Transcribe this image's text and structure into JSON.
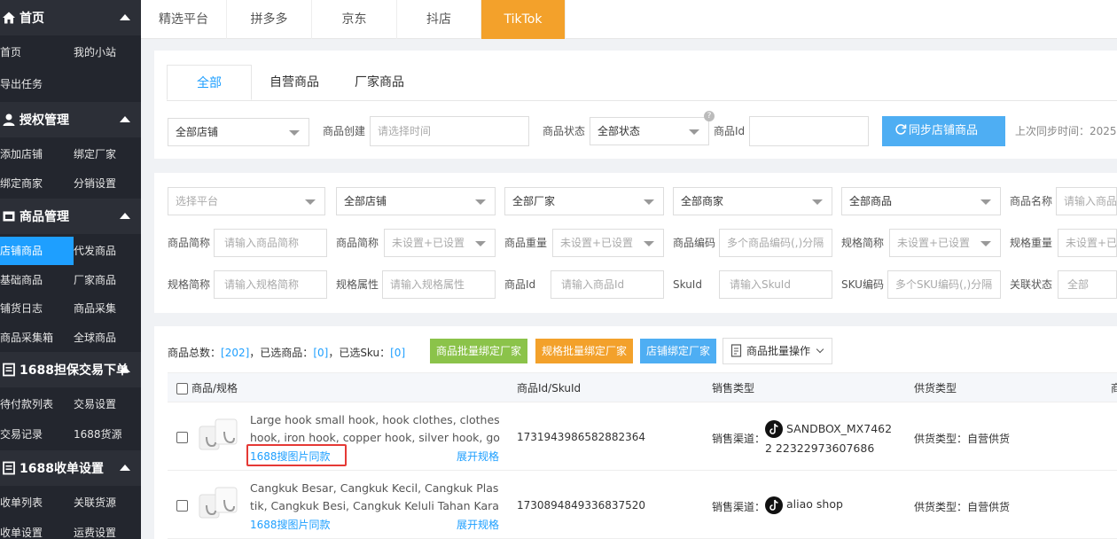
{
  "sidebar": {
    "sections": [
      {
        "title": "首页",
        "icon": "home-icon",
        "items": [
          "首页",
          "我的小站",
          "导出任务"
        ]
      },
      {
        "title": "授权管理",
        "icon": "user-icon",
        "items": [
          "添加店铺",
          "绑定厂家",
          "绑定商家",
          "分销设置"
        ]
      },
      {
        "title": "商品管理",
        "icon": "box-icon",
        "items": [
          "店铺商品",
          "代发商品",
          "基础商品",
          "厂家商品",
          "铺货日志",
          "商品采集",
          "商品采集箱",
          "全球商品"
        ]
      },
      {
        "title": "1688担保交易下单",
        "icon": "list-icon",
        "items": [
          "待付款列表",
          "交易设置",
          "交易记录",
          "1688货源"
        ]
      },
      {
        "title": "1688收单设置",
        "icon": "list-icon",
        "items": [
          "收单列表",
          "关联货源",
          "收单设置",
          "运费设置"
        ]
      }
    ]
  },
  "top_tabs": [
    "精选平台",
    "拼多多",
    "京东",
    "抖店",
    "TikTok"
  ],
  "sub_tabs": [
    "全部",
    "自营商品",
    "厂家商品"
  ],
  "filter1": {
    "shop_select": "全部店铺",
    "created_label": "商品创建",
    "created_placeholder": "请选择时间",
    "status_label": "商品状态",
    "status_select": "全部状态",
    "id_label": "商品Id",
    "sync_button": "同步店铺商品",
    "last_sync": "上次同步时间：2025-"
  },
  "filter2": {
    "row1": {
      "platform_placeholder": "选择平台",
      "shop": "全部店铺",
      "factory": "全部厂家",
      "merchant": "全部商家",
      "goods": "全部商品",
      "name_label": "商品名称",
      "name_placeholder": "请输入商品"
    },
    "row2": {
      "short_label": "商品简称",
      "short_placeholder": "请输入商品简称",
      "short2_label": "商品简称",
      "short2_select": "未设置+已设置",
      "weight_label": "商品重量",
      "weight_select": "未设置+已设置",
      "code_label": "商品编码",
      "code_placeholder": "多个商品编码(,)分隔",
      "spec_short_label": "规格简称",
      "spec_short_select": "未设置+已设置",
      "spec_weight_label": "规格重量",
      "spec_weight_select": "未设置+已设"
    },
    "row3": {
      "spec_short_label": "规格简称",
      "spec_short_placeholder": "请输入规格简称",
      "spec_attr_label": "规格属性",
      "spec_attr_placeholder": "请输入规格属性",
      "id_label": "商品Id",
      "id_placeholder": "请输入商品Id",
      "sku_label": "SkuId",
      "sku_placeholder": "请输入SkuId",
      "sku_code_label": "SKU编码",
      "sku_code_placeholder": "多个SKU编码(,)分隔",
      "rel_label": "关联状态",
      "rel_select": "全部"
    }
  },
  "summary": {
    "total_label": "商品总数：",
    "total": "[202]",
    "selected_label": "，已选商品：",
    "selected": "[0]",
    "sku_label": "，已选Sku：",
    "sku": "[0]"
  },
  "actions": {
    "bind_goods": "商品批量绑定厂家",
    "bind_spec": "规格批量绑定厂家",
    "bind_shop": "店铺绑定厂家",
    "batch_ops": "商品批量操作"
  },
  "table": {
    "headers": [
      "商品/规格",
      "商品Id/SkuId",
      "销售类型",
      "供货类型",
      "商"
    ],
    "rows": [
      {
        "title": "Large hook small hook, hook clothes, clothes hook, iron hook, copper hook, silver hook, gold h...",
        "img_search": "1688搜图片同款",
        "expand": "展开规格",
        "id": "1731943986582882364",
        "channel_label": "销售渠道：",
        "channel": "SANDBOX_MX74622 22322973607686",
        "supply_label": "供货类型：",
        "supply": "自营供货"
      },
      {
        "title": "Cangkuk Besar, Cangkuk Kecil, Cangkuk Plastik, Cangkuk Besi, Cangkuk Keluli Tahan Karat, Mel...",
        "img_search": "1688搜图片同款",
        "expand": "展开规格",
        "id": "1730894849336837520",
        "channel_label": "销售渠道：",
        "channel": "aliao shop",
        "supply_label": "供货类型：",
        "supply": "自营供货"
      }
    ]
  },
  "colors": {
    "accent": "#1e9fff",
    "tiktok_tab": "#f3a12b",
    "sidebar": "#23262e",
    "highlight_box": "#e53935"
  }
}
